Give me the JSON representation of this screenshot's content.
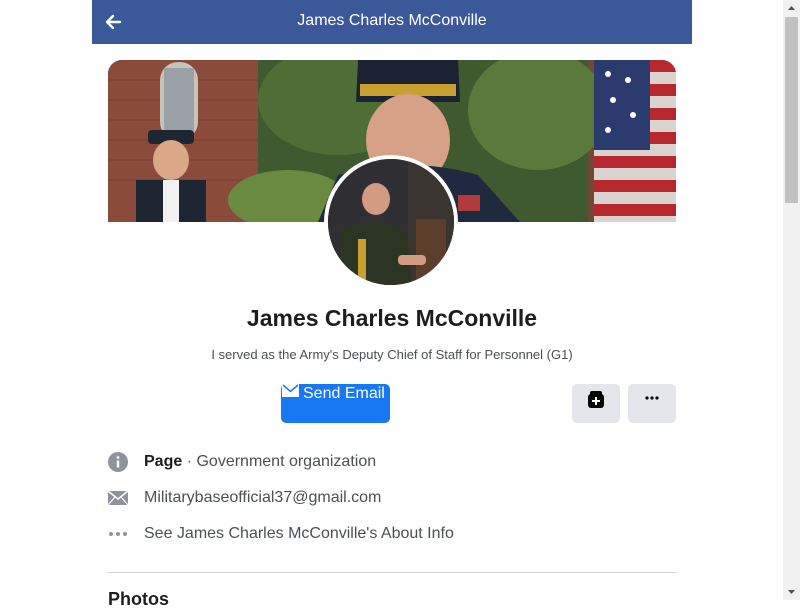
{
  "header": {
    "title": "James Charles McConville",
    "back_icon": "arrow-left-icon",
    "background": "#3b5998"
  },
  "profile": {
    "name": "James Charles McConville",
    "bio": "I served as the Army's Deputy Chief of Staff for Personnel (G1)"
  },
  "actions": {
    "send_email_label": "Send Email",
    "send_email_icon": "envelope-icon",
    "save_icon": "bookmark-plus-icon",
    "more_icon": "more-horizontal-icon",
    "primary_color": "#1877f2"
  },
  "info": {
    "page_type_bold": "Page",
    "page_category": " · Government organization",
    "email": "Militarybaseofficial37@gmail.com",
    "about_link": "See James Charles McConville's About Info"
  },
  "sections": {
    "photos_title": "Photos"
  }
}
